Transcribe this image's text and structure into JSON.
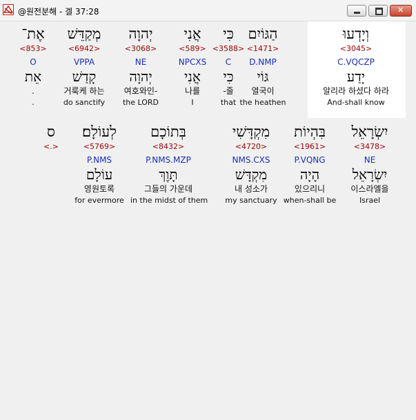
{
  "window": {
    "title": "@원전분해 - 겔 37:28",
    "minimize_label": "",
    "maximize_label": "",
    "close_label": ""
  },
  "row1": [
    {
      "heb": "וְיָדְעוּ",
      "strong": "<3045>",
      "lex": "",
      "morph": "C.VQCZP",
      "lex2": "יָדַע",
      "kor": "알리라 하셨다 하라",
      "eng": "And-shall know"
    },
    {
      "heb": "הַגּוֹיִם",
      "strong": "<1471>",
      "morph": "D.NMP",
      "lex2": "גּוֹי",
      "kor": "열국이",
      "eng": "the heathen"
    },
    {
      "heb": "כִּי",
      "strong": "<3588>",
      "morph": "C",
      "lex2": "כִּי",
      "kor": "-줄",
      "eng": "that"
    },
    {
      "heb": "אֲנִי",
      "strong": "<589>",
      "morph": "NPCXS",
      "lex2": "אֲנִי",
      "kor": "나를",
      "eng": "I"
    },
    {
      "heb": "יְהוָה",
      "strong": "<3068>",
      "morph": "NE",
      "lex2": "יְהוָה",
      "kor": "여호와인-",
      "eng": "the LORD"
    },
    {
      "heb": "מְקַדֵּשׁ",
      "strong": "<6942>",
      "morph": "VPPA",
      "lex2": "קָדַשׁ",
      "kor": "거룩케 하는",
      "eng": "do sanctify"
    },
    {
      "heb": "אֶת־",
      "strong": "<853>",
      "morph": "O",
      "lex2": "אֵת",
      "kor": ".",
      "eng": "."
    }
  ],
  "row2": [
    {
      "heb": "יִשְׂרָאֵל",
      "strong": "<3478>",
      "morph": "NE",
      "lex2": "יִשְׂרָאֵל",
      "kor": "이스라엘을",
      "eng": "Israel"
    },
    {
      "heb": "בִּהְיוֹת",
      "strong": "<1961>",
      "morph": "P.VQNG",
      "lex2": "הָיָה",
      "kor": "있으리니",
      "eng": "when-shall be"
    },
    {
      "heb": "מִקְדָּשִׁי",
      "strong": "<4720>",
      "morph": "NMS.CXS",
      "lex2": "מִקְדָּשׁ",
      "kor": "내 성소가",
      "eng": "my sanctuary"
    },
    {
      "heb": "בְּתוֹכָם",
      "strong": "<8432>",
      "morph": "P.NMS.MZP",
      "lex2": "תָּוֶךְ",
      "kor": "그들의 가운데",
      "eng": "in the midst of them"
    },
    {
      "heb": "לְעוֹלָם׃",
      "strong": "<5769>",
      "morph": "P.NMS",
      "lex2": "עוֹלָם",
      "kor": "영원토록",
      "eng": "for evermore"
    },
    {
      "heb": "ס",
      "strong": "<.>",
      "morph": "",
      "lex2": "",
      "kor": "",
      "eng": ""
    }
  ]
}
